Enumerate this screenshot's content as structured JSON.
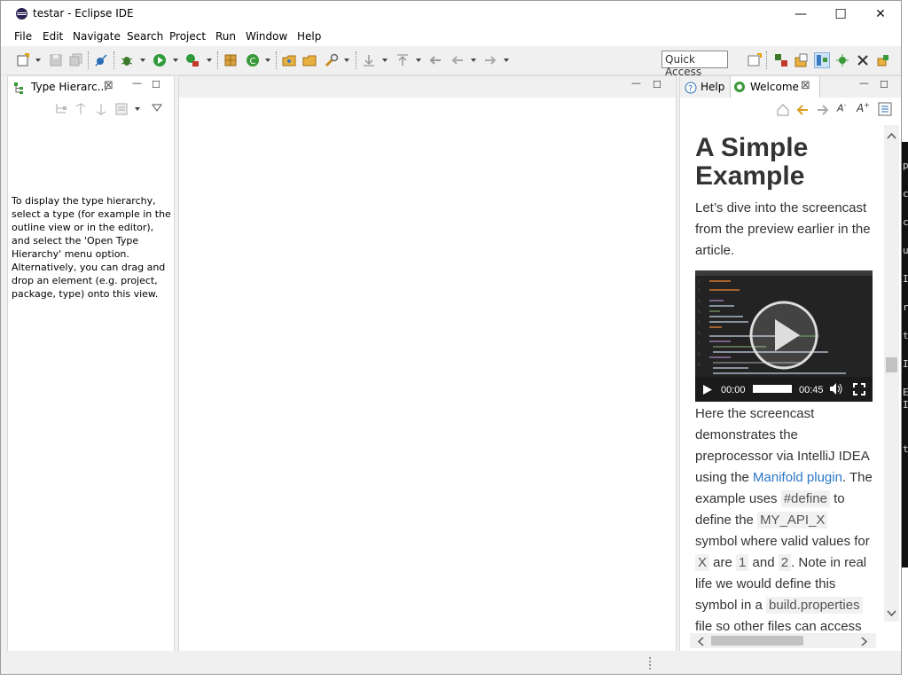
{
  "window": {
    "title": "testar - Eclipse IDE",
    "controls": {
      "minimize": "—",
      "maximize": "☐",
      "close": "✕"
    }
  },
  "menu": [
    "File",
    "Edit",
    "Navigate",
    "Search",
    "Project",
    "Run",
    "Window",
    "Help"
  ],
  "toolbar": {
    "quick_access": "Quick Access"
  },
  "type_hierarchy": {
    "tab_label": "Type Hierarc...",
    "message": "To display the type hierarchy, select a type (for example in the outline view or in the editor), and select the 'Open Type Hierarchy' menu option. Alternatively, you can drag and drop an element (e.g. project, package, type) onto this view."
  },
  "right_panel": {
    "tabs": [
      "Help",
      "Welcome"
    ],
    "active_tab": "Welcome"
  },
  "welcome": {
    "heading": "A Simple Example",
    "intro": "Let’s dive into the screencast from the preview earlier in the article.",
    "video": {
      "current_time": "00:00",
      "duration": "00:45",
      "progress": 0
    },
    "p2_a": "Here the screencast demonstrates the preprocessor via IntelliJ IDEA using the ",
    "p2_link": "Manifold plugin",
    "p2_b": ". The example uses ",
    "code_define": "#define",
    "p2_c": " to define the ",
    "code_symbol": "MY_API_X",
    "p2_d": " symbol where valid values for ",
    "code_x": "X",
    "p2_e": " are ",
    "code_1": "1",
    "p2_f": " and ",
    "code_2": "2",
    "p2_g": ". Note in real life we would define this symbol in a ",
    "code_build": "build.properties",
    "p2_h": " file so other files can access it, but here"
  },
  "background_terminal_chars": [
    "p",
    "c",
    "c",
    "u",
    "I",
    "r",
    "t",
    "I",
    "E",
    "I",
    "t"
  ],
  "colors": {
    "accent_link": "#2b78c5",
    "window_bg": "#f0f0f0"
  }
}
